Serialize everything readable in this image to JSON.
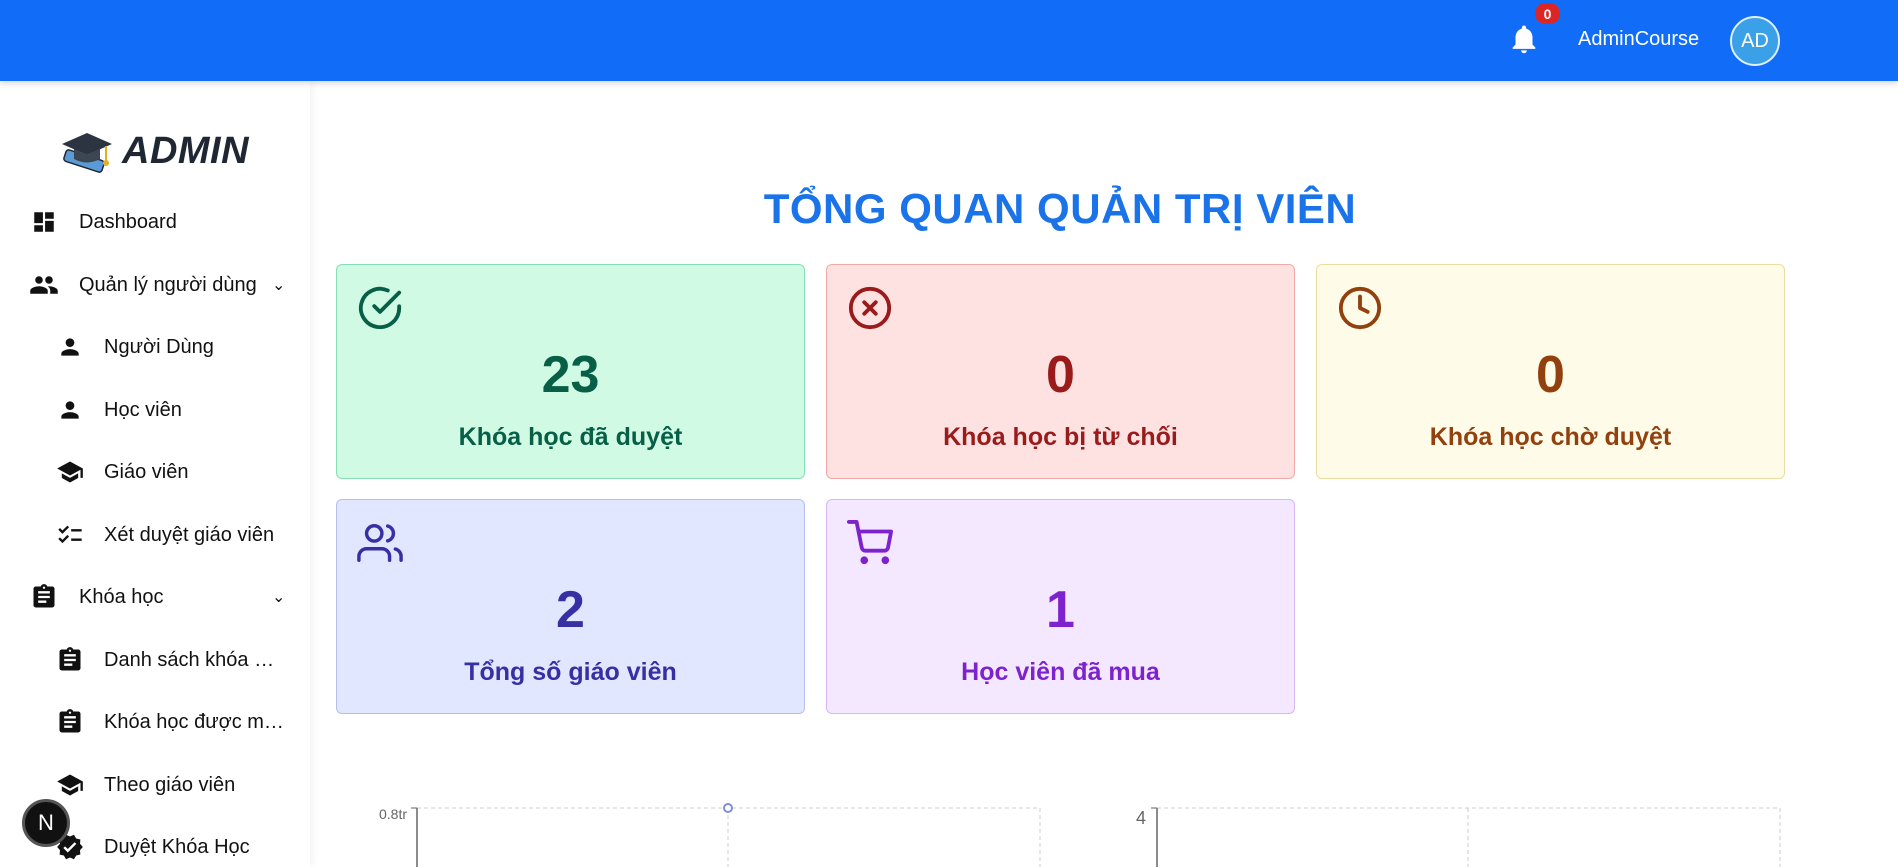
{
  "header": {
    "notification_count": "0",
    "username": "AdminCourse",
    "avatar_initials": "AD",
    "bg_color": "#116df8"
  },
  "sidebar": {
    "brand": "ADMIN",
    "items": [
      {
        "label": "Dashboard",
        "icon": "dashboard-icon"
      },
      {
        "label": "Quản lý người dùng",
        "icon": "users-icon",
        "expanded": true
      },
      {
        "label": "Người Dùng",
        "icon": "person-icon"
      },
      {
        "label": "Học viên",
        "icon": "person-icon"
      },
      {
        "label": "Giáo viên",
        "icon": "school-icon"
      },
      {
        "label": "Xét duyệt giáo viên",
        "icon": "checklist-icon"
      },
      {
        "label": "Khóa học",
        "icon": "clipboard-icon",
        "expanded": true
      },
      {
        "label": "Danh sách khóa …",
        "icon": "clipboard-icon"
      },
      {
        "label": "Khóa học được m…",
        "icon": "clipboard-icon"
      },
      {
        "label": "Theo giáo viên",
        "icon": "school-icon"
      },
      {
        "label": "Duyệt Khóa Học",
        "icon": "verified-icon"
      }
    ],
    "floating_button": "N"
  },
  "main": {
    "title": "TỔNG QUAN QUẢN TRỊ VIÊN",
    "stats": [
      {
        "value": "23",
        "label": "Khóa học đã duyệt",
        "icon": "check-circle-icon",
        "bg": "#d1fae5",
        "border": "#86e0b6",
        "color": "#065f46"
      },
      {
        "value": "0",
        "label": "Khóa học bị từ chối",
        "icon": "x-circle-icon",
        "bg": "#fee2e2",
        "border": "#f5a8a8",
        "color": "#991b1b"
      },
      {
        "value": "0",
        "label": "Khóa học chờ duyệt",
        "icon": "clock-icon",
        "bg": "#fefce8",
        "border": "#ebdca0",
        "color": "#92400e"
      },
      {
        "value": "2",
        "label": "Tổng số giáo viên",
        "icon": "users-outline-icon",
        "bg": "#e0e7ff",
        "border": "#b4bff0",
        "color": "#3730a3"
      },
      {
        "value": "1",
        "label": "Học viên đã mua",
        "icon": "cart-icon",
        "bg": "#f3e8ff",
        "border": "#d6b8f5",
        "color": "#7e22ce"
      }
    ]
  },
  "chart_data": [
    {
      "type": "line",
      "ytick_label": "0.8tr",
      "ylim_top": 0.8,
      "points": [
        {
          "x": 0,
          "y": 0.8
        }
      ],
      "grid": true,
      "color": "#8090d0"
    },
    {
      "type": "bar",
      "ytick_label": "4",
      "ylim_top": 4,
      "grid": true
    }
  ]
}
